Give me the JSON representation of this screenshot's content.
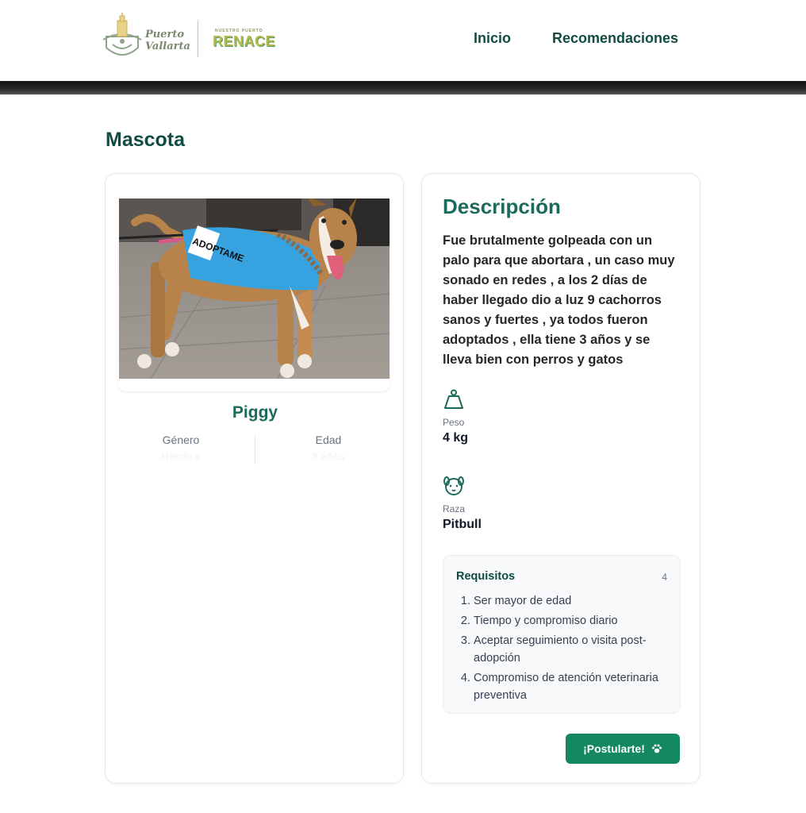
{
  "header": {
    "logo_city_line1": "Puerto",
    "logo_city_line2": "Vallarta",
    "logo_tagline_small": "NUESTRO PUERTO",
    "logo_tagline_big": "RENACE",
    "nav": [
      {
        "label": "Inicio"
      },
      {
        "label": "Recomendaciones"
      }
    ]
  },
  "page": {
    "title": "Mascota"
  },
  "pet": {
    "name": "Piggy",
    "photo_vest_text": "ADOPTAME",
    "stats": [
      {
        "label": "Género",
        "value": "Hembra"
      },
      {
        "label": "Edad",
        "value": "3 años"
      }
    ]
  },
  "description": {
    "title": "Descripción",
    "text": "Fue brutalmente golpeada con un palo para que abortara , un caso muy sonado en redes , a los 2 días de haber llegado dio a luz 9 cachorros sanos y fuertes , ya todos fueron adoptados , ella tiene 3 años y se lleva bien con perros y gatos",
    "attributes": [
      {
        "label": "Peso",
        "value": "4 kg",
        "icon": "weight-icon"
      },
      {
        "label": "Raza",
        "value": "Pitbull",
        "icon": "dog-face-icon"
      }
    ]
  },
  "requirements": {
    "title": "Requisitos",
    "count": "4",
    "items": [
      {
        "num": "1.",
        "text": "Ser mayor de edad"
      },
      {
        "num": "2.",
        "text": "Tiempo y compromiso diario"
      },
      {
        "num": "3.",
        "text": "Aceptar seguimiento o visita post-adopción"
      },
      {
        "num": "4.",
        "text": "Compromiso de atención veterinaria preventiva"
      }
    ]
  },
  "apply_button": {
    "label": "¡Postularte!",
    "icon": "paw-icon"
  },
  "colors": {
    "primary": "#1b6b5b",
    "dark_green": "#0f4c42",
    "button": "#14895f"
  }
}
